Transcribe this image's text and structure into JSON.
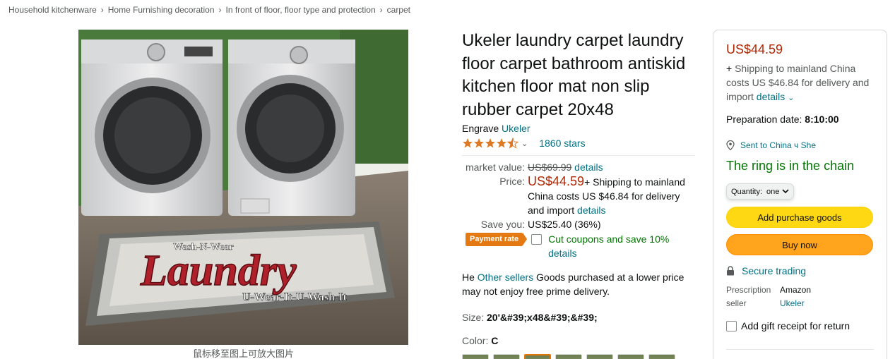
{
  "breadcrumb": [
    "Household kitchenware",
    "Home Furnishing decoration",
    "In front of floor, floor type and protection",
    "carpet"
  ],
  "breadcrumb_sep": "›",
  "image": {
    "caption": "鼠标移至图上可放大图片",
    "mat_line1": "Wash-N-Wear",
    "mat_line2": "Laundry",
    "mat_line3": "U-Wear-It-U-Wash-It"
  },
  "product": {
    "title": "Ukeler laundry carpet laundry floor carpet bathroom antiskid kitchen floor mat non slip rubber carpet 20x48",
    "brand_prefix": "Engrave",
    "brand": "Ukeler",
    "rating_stars": 4.5,
    "rating_count": "1860 stars"
  },
  "pricing": {
    "market_label": "market value:",
    "market_value": "US$69.99",
    "market_details": "details",
    "price_label": "Price:",
    "price": "US$44.59",
    "price_shipping": "+ Shipping to mainland China costs US $46.84 for delivery and import",
    "price_details": "details",
    "save_label": "Save you:",
    "save_value": "US$25.40 (36%)",
    "coupon_badge": "Payment rate",
    "coupon_text": "Cut coupons and save 10%",
    "coupon_details": "details"
  },
  "seller_note": {
    "prefix": "He",
    "link": "Other sellers",
    "suffix": "Goods purchased at a lower price may not enjoy free prime delivery."
  },
  "size": {
    "label": "Size:",
    "value": "20'&#39;x48&#39;&#39;"
  },
  "color": {
    "label": "Color:",
    "value": "C"
  },
  "buybox": {
    "price": "US$44.59",
    "shipping_plus": "+",
    "shipping": "Shipping to mainland China costs US $46.84 for delivery and import",
    "shipping_details": "details",
    "prep_label": "Preparation date:",
    "prep_value": "8:10:00",
    "location": "Sent to China ч She",
    "stock": "The ring is in the chain",
    "qty_label": "Quantity:",
    "qty_value": "one",
    "add_cart": "Add purchase goods",
    "buy_now": "Buy now",
    "secure": "Secure trading",
    "seller_label_1": "Prescription",
    "seller_value_1": "Amazon",
    "seller_label_2": "seller",
    "seller_value_2": "Ukeler",
    "gift": "Add gift receipt for return"
  },
  "colors": {
    "price_red": "#b12704",
    "link": "#007185",
    "instock": "#007600",
    "cart_btn": "#ffd814",
    "buy_btn": "#ffa41c",
    "star": "#de7921"
  }
}
